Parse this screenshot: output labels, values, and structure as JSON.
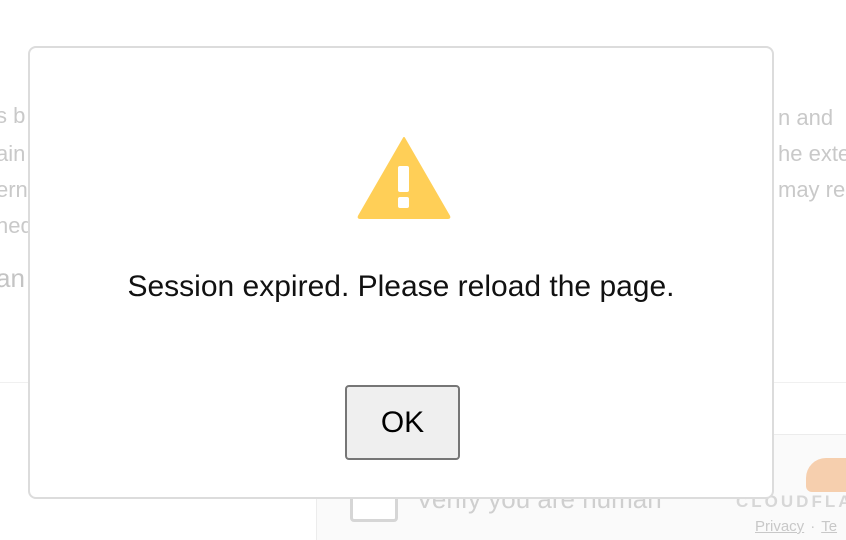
{
  "background": {
    "left_lines": [
      "s b",
      "ain",
      "ern",
      "ned"
    ],
    "left_big": "an",
    "right_lines": [
      "n and",
      "he exte",
      "may re"
    ]
  },
  "captcha": {
    "label": "Verify you are human",
    "brand": "CLOUDFLA",
    "privacy_link": "Privacy",
    "separator": "·",
    "terms_link": "Te"
  },
  "dialog": {
    "icon": "warning-triangle-icon",
    "icon_color": "#FFCF57",
    "message": "Session expired. Please reload the page.",
    "ok_label": "OK"
  }
}
